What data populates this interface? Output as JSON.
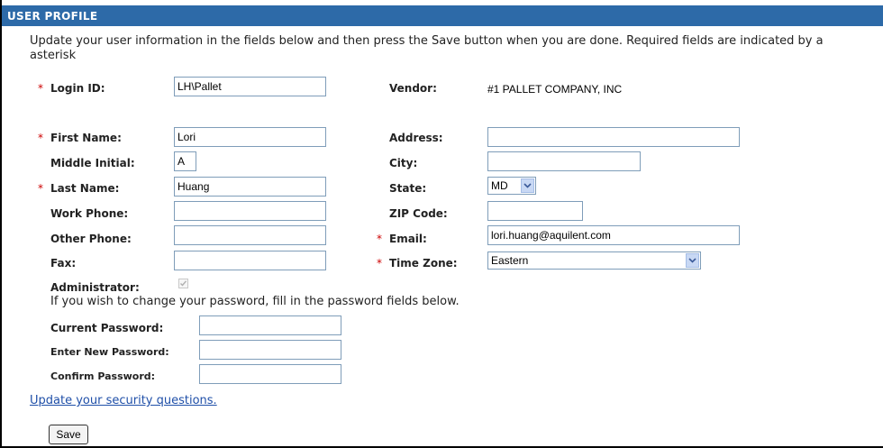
{
  "header": {
    "title": "User Profile"
  },
  "intro": {
    "line1": "Update your user information in the fields below and then press the Save button when you are done. Required fields are indicated by a",
    "line2": "asterisk"
  },
  "required_mark": "*",
  "fields": {
    "login_id": {
      "label": "Login ID:",
      "value": "LH\\Pallet"
    },
    "vendor": {
      "label": "Vendor:",
      "value": "#1 PALLET COMPANY, INC"
    },
    "first_name": {
      "label": "First Name:",
      "value": "Lori"
    },
    "middle_initial": {
      "label": "Middle Initial:",
      "value": "A"
    },
    "last_name": {
      "label": "Last Name:",
      "value": "Huang"
    },
    "work_phone": {
      "label": "Work Phone:",
      "value": ""
    },
    "other_phone": {
      "label": "Other Phone:",
      "value": ""
    },
    "fax": {
      "label": "Fax:",
      "value": ""
    },
    "address": {
      "label": "Address:",
      "value": ""
    },
    "city": {
      "label": "City:",
      "value": ""
    },
    "state": {
      "label": "State:",
      "value": "MD"
    },
    "zip": {
      "label": "ZIP Code:",
      "value": ""
    },
    "email": {
      "label": "Email:",
      "value": "lori.huang@aquilent.com"
    },
    "time_zone": {
      "label": "Time Zone:",
      "value": "Eastern"
    },
    "administrator": {
      "label": "Administrator:",
      "checked": true
    }
  },
  "password": {
    "instructions": "If you wish to change your password, fill in the password fields below.",
    "current_label": "Current Password:",
    "new_label": "Enter New Password:",
    "confirm_label": "Confirm Password:"
  },
  "security_link": "Update your security questions.",
  "save_label": "Save",
  "colors": {
    "header_bg": "#2d6aa8",
    "required": "#cc0000",
    "link": "#1f4fa8"
  },
  "icons": {
    "dropdown": "chevron-down-icon",
    "checkmark": "check-icon"
  }
}
